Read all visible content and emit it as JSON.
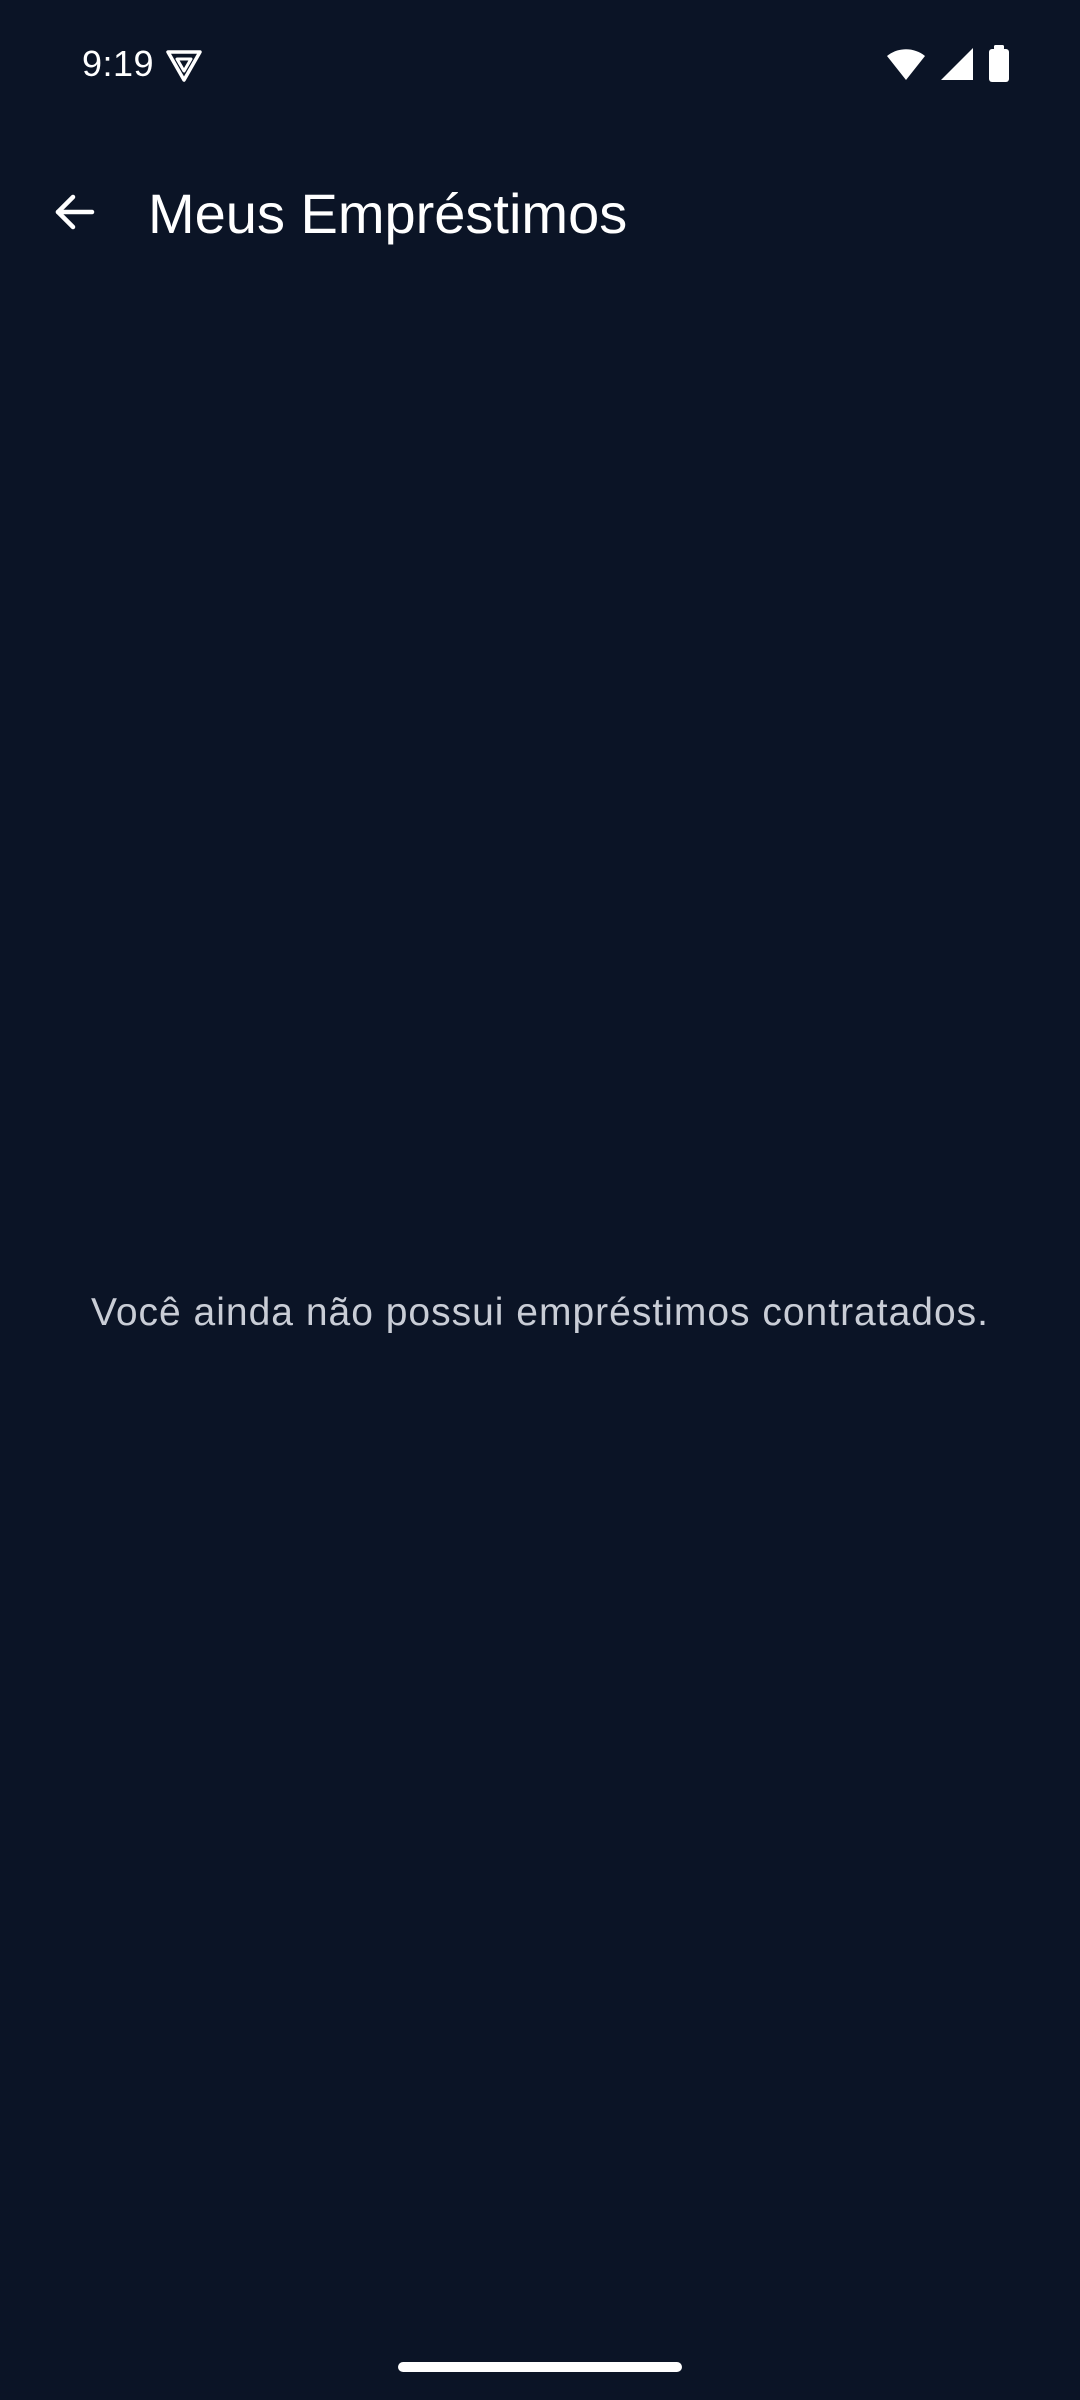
{
  "status_bar": {
    "time": "9:19",
    "app_icon": "vpn-shield-icon",
    "icons": [
      "wifi-icon",
      "cell-signal-icon",
      "battery-icon"
    ]
  },
  "app_bar": {
    "back_icon": "arrow-back-icon",
    "title": "Meus Empréstimos"
  },
  "content": {
    "empty_message": "Você ainda não possui empréstimos contratados."
  },
  "colors": {
    "background": "#0b1426",
    "text_primary": "#ffffff",
    "text_secondary": "#c9cdd6"
  }
}
